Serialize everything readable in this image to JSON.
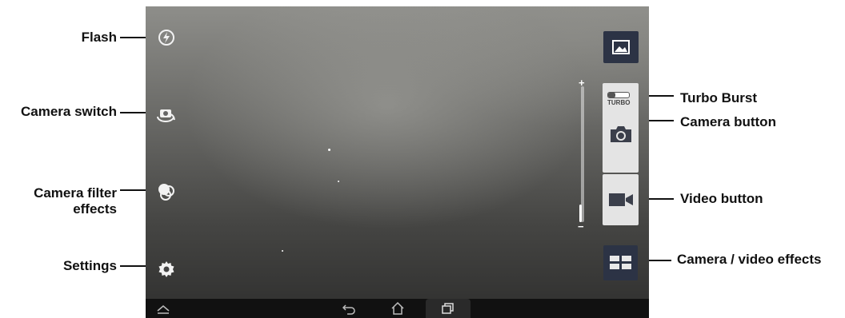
{
  "callouts": {
    "flash": "Flash",
    "camera_switch": "Camera switch",
    "camera_filter_line1": "Camera filter",
    "camera_filter_line2": "effects",
    "settings": "Settings",
    "turbo_burst": "Turbo Burst",
    "camera_button": "Camera button",
    "video_button": "Video button",
    "camera_video_effects": "Camera / video effects"
  },
  "camera_ui": {
    "turbo_label": "TURBO",
    "zoom_plus": "+",
    "zoom_minus": "−",
    "zoom_level": 0.1
  },
  "icons": {
    "flash": "flash-off-icon",
    "camera_switch": "camera-switch-icon",
    "filter": "filter-effects-icon",
    "settings": "gear-icon",
    "gallery": "gallery-icon",
    "camera": "camera-icon",
    "video": "video-camera-icon",
    "effects": "grid-effects-icon",
    "nav": [
      "chevron-up-icon",
      "back-icon",
      "home-icon",
      "recents-icon"
    ]
  },
  "colors": {
    "dark_button": "#2c3345",
    "light_button": "#e4e4e4",
    "nav_bar": "#111111"
  }
}
